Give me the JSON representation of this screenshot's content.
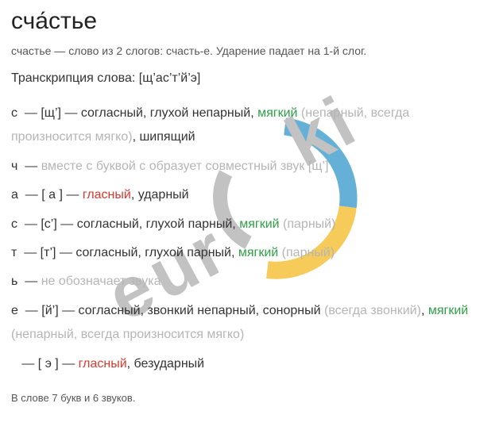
{
  "title": "сча́стье",
  "intro": "счастье — слово из 2 слогов: счасть-е. Ударение падает на 1-й слог.",
  "transcription_label": "Транскрипция слова: ",
  "transcription_value": "[щ’ас’т’й’э]",
  "rows": [
    {
      "letter": "с",
      "sound": "[щ’]",
      "parts": [
        {
          "t": " — согласный, глухой непарный, ",
          "c": "black"
        },
        {
          "t": "мягкий",
          "c": "green"
        },
        {
          "t": " (непарный, всегда произносится мягко)",
          "c": "gray"
        },
        {
          "t": ", шипящий",
          "c": "black"
        }
      ]
    },
    {
      "letter": "ч",
      "sound": "",
      "parts": [
        {
          "t": "вместе с буквой с образует совместный звук [щ’]",
          "c": "gray"
        }
      ]
    },
    {
      "letter": "а",
      "sound": "[ а ]",
      "parts": [
        {
          "t": " — ",
          "c": "black"
        },
        {
          "t": "гласный",
          "c": "red"
        },
        {
          "t": ", ударный",
          "c": "black"
        }
      ]
    },
    {
      "letter": "с",
      "sound": "[с’]",
      "parts": [
        {
          "t": " — согласный, глухой парный, ",
          "c": "black"
        },
        {
          "t": "мягкий",
          "c": "green"
        },
        {
          "t": " (парный)",
          "c": "gray"
        }
      ]
    },
    {
      "letter": "т",
      "sound": "[т’]",
      "parts": [
        {
          "t": " — согласный, глухой парный, ",
          "c": "black"
        },
        {
          "t": "мягкий",
          "c": "green"
        },
        {
          "t": " (парный)",
          "c": "gray"
        }
      ]
    },
    {
      "letter": "ь",
      "sound": "",
      "parts": [
        {
          "t": "не обозначает звука",
          "c": "gray"
        }
      ]
    },
    {
      "letter": "е",
      "sound": "[й’]",
      "parts": [
        {
          "t": " — согласный, звонкий непарный, сонорный ",
          "c": "black"
        },
        {
          "t": "(всегда звонкий)",
          "c": "gray"
        },
        {
          "t": ", ",
          "c": "black"
        },
        {
          "t": "мягкий",
          "c": "green"
        },
        {
          "t": " (непарный, всегда произносится мягко)",
          "c": "gray"
        }
      ]
    },
    {
      "letter": "",
      "sound": "[ э ]",
      "parts": [
        {
          "t": " — ",
          "c": "black"
        },
        {
          "t": "гласный",
          "c": "red"
        },
        {
          "t": ", безударный",
          "c": "black"
        }
      ]
    }
  ],
  "summary": "В слове 7 букв и 6 звуков.",
  "watermark": {
    "text": "euroki"
  }
}
